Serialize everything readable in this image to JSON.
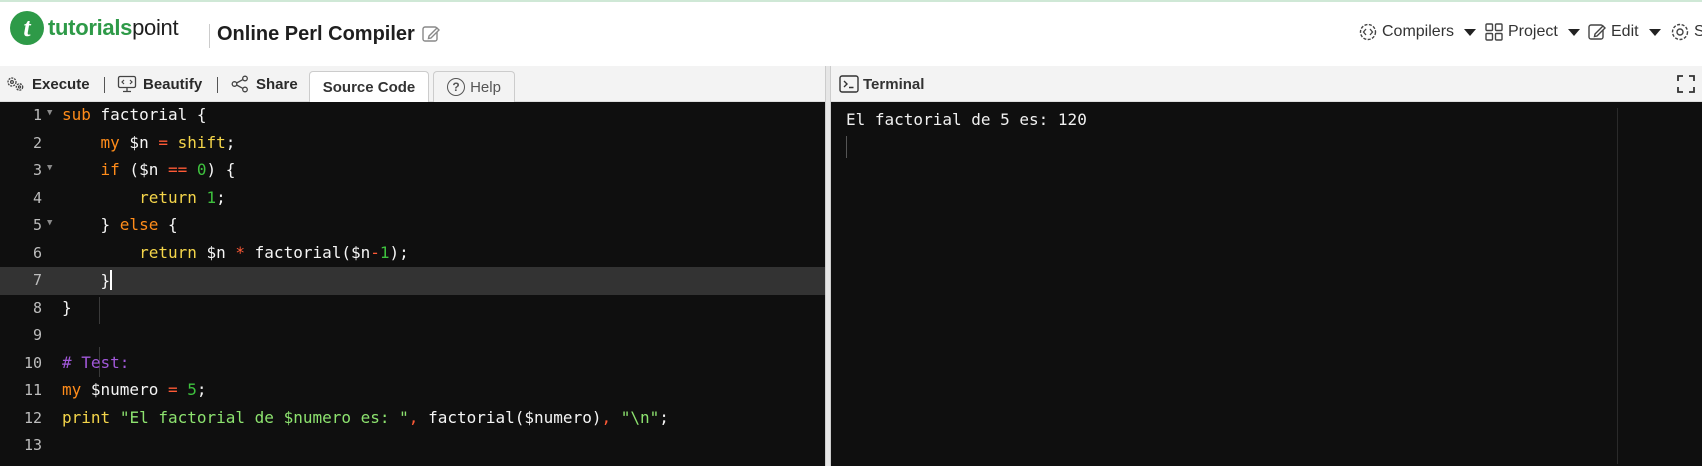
{
  "header": {
    "logo_part1": "tutorials",
    "logo_part2": "point",
    "page_title": "Online Perl Compiler",
    "nav": {
      "compilers": "Compilers",
      "project": "Project",
      "edit": "Edit",
      "settings_partial": "S"
    }
  },
  "toolbar": {
    "execute": "Execute",
    "beautify": "Beautify",
    "share": "Share",
    "source_code_tab": "Source Code",
    "help_tab": "Help"
  },
  "editor": {
    "active_line": 7,
    "line_numbers": [
      "1",
      "2",
      "3",
      "4",
      "5",
      "6",
      "7",
      "8",
      "9",
      "10",
      "11",
      "12",
      "13"
    ],
    "fold_markers_on_lines": [
      1,
      3,
      5
    ]
  },
  "terminal": {
    "title": "Terminal",
    "output": "El factorial de 5 es: 120"
  },
  "colors": {
    "brand_green": "#2e9a48",
    "editor_bg": "#0f0f0f",
    "keyword_orange": "#ff8c1a",
    "builtin_yellow": "#f4d54a",
    "number_green": "#3ec23e",
    "string_green": "#8de36f",
    "comment_purple": "#a158d9"
  }
}
